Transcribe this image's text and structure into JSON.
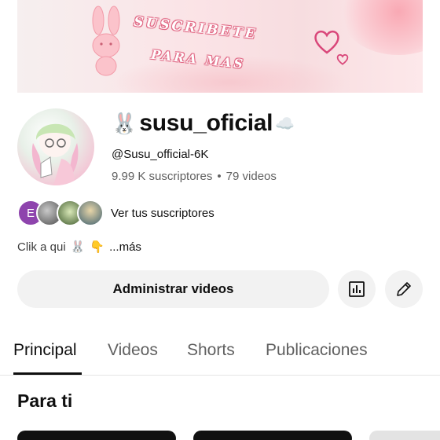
{
  "banner": {
    "line1": "SUSCRIBETE",
    "line2": "PARA MAS"
  },
  "channel": {
    "title_icon": "🐰",
    "name": "susu_oficial",
    "title_suffix_icon": "☁️",
    "handle": "@Susu_official-6K",
    "subscribers": "9.99 K suscriptores",
    "separator": "•",
    "videos": "79 videos"
  },
  "subscribers_preview": {
    "first_initial": "E",
    "label": "Ver tus suscriptores"
  },
  "description": {
    "text": "Clik a qui",
    "emoji1": "🐰",
    "emoji2": "👇",
    "more": "...más"
  },
  "actions": {
    "manage_label": "Administrar videos",
    "analytics_icon": "bar-chart-icon",
    "edit_icon": "pencil-icon"
  },
  "tabs": [
    {
      "label": "Principal",
      "active": true
    },
    {
      "label": "Videos",
      "active": false
    },
    {
      "label": "Shorts",
      "active": false
    },
    {
      "label": "Publicaciones",
      "active": false
    }
  ],
  "section": {
    "title": "Para ti"
  },
  "colors": {
    "accent_avatar": "#8e44ad",
    "button_bg": "#f2f2f2",
    "text_primary": "#0f0f0f",
    "text_secondary": "#606060"
  }
}
